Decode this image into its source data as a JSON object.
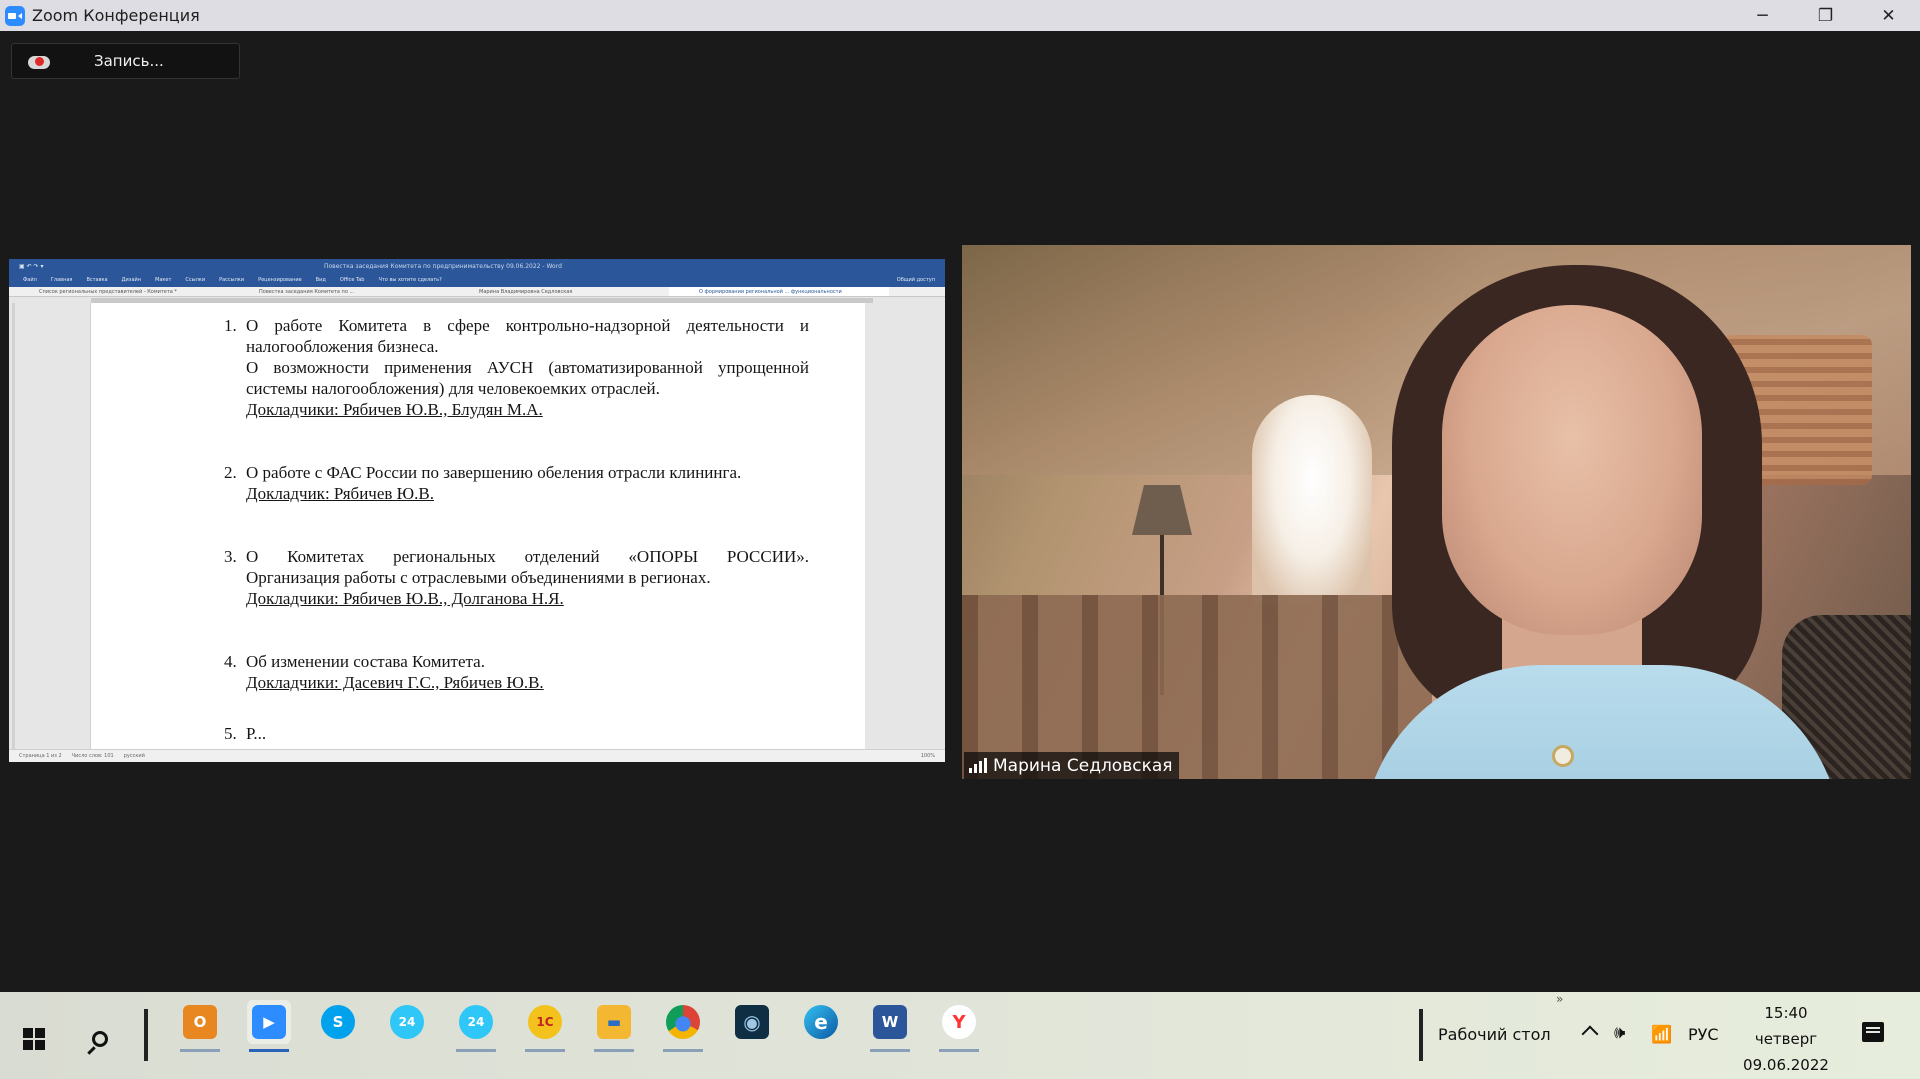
{
  "window": {
    "title": "Zoom Конференция",
    "minimize": "─",
    "restore": "❐",
    "close": "✕"
  },
  "recording": {
    "label": "Запись..."
  },
  "word": {
    "title_bar": "Повестка заседания Комитета по предпринимательству 09.06.2022 - Word",
    "ribbon_tabs": [
      "Файл",
      "Главная",
      "Вставка",
      "Дизайн",
      "Макет",
      "Ссылки",
      "Рассылки",
      "Рецензирование",
      "Вид",
      "Office Tab",
      "Что вы хотите сделать?"
    ],
    "share_label": "Общий доступ",
    "doc_tabs": [
      "Список региональных представителей - Комитета *",
      "Повестка заседания Комитета по ...",
      "Марина Владимировна Седловская",
      "О формировании региональной ... функциональности"
    ],
    "status_left": [
      "Страница 1 из 2",
      "Число слов: 101",
      "русский"
    ],
    "status_zoom": "100%",
    "items": [
      {
        "num": "1.",
        "line1": "О работе Комитета в сфере контрольно-надзорной деятельности и",
        "line2": "налогообложения бизнеса.",
        "line3": "О возможности применения АУСН (автоматизированной упрощенной",
        "line4": "системы налогообложения) для человекоемких отраслей.",
        "speakers": "Докладчики: Рябичев Ю.В., Блудян М.А."
      },
      {
        "num": "2.",
        "line1": "О работе с ФАС России по завершению обеления отрасли клининга.",
        "speakers": "Докладчик: Рябичев Ю.В."
      },
      {
        "num": "3.",
        "line1": "О Комитетах региональных отделений «ОПОРЫ РОССИИ».",
        "line2": "Организация работы с отраслевыми объединениями в регионах.",
        "speakers": "Докладчики: Рябичев Ю.В., Долганова Н.Я."
      },
      {
        "num": "4.",
        "line1": "Об изменении состава Комитета.",
        "speakers": "Докладчики: Дасевич Г.С., Рябичев Ю.В."
      },
      {
        "num": "5.",
        "line1": "Р..."
      }
    ]
  },
  "participant": {
    "name": "Марина Седловская"
  },
  "taskbar": {
    "apps": [
      {
        "name": "outlook",
        "label": "O",
        "color": "#e8861f"
      },
      {
        "name": "zoom",
        "label": "▶",
        "color": "#2d8cff"
      },
      {
        "name": "skype",
        "label": "S",
        "color": "#00a2ed"
      },
      {
        "name": "bitrix24-a",
        "label": "24",
        "color": "#2fc7f7"
      },
      {
        "name": "bitrix24-b",
        "label": "24",
        "color": "#2fc7f7"
      },
      {
        "name": "1c",
        "label": "1С",
        "color": "#f3c21c"
      },
      {
        "name": "file-explorer",
        "label": "▬",
        "color": "#f4b731"
      },
      {
        "name": "chrome",
        "label": "●",
        "color": "#db4437"
      },
      {
        "name": "camera-app",
        "label": "◉",
        "color": "#0f2e44"
      },
      {
        "name": "edge",
        "label": "e",
        "color": "#1b9de2"
      },
      {
        "name": "word",
        "label": "W",
        "color": "#2b579a"
      },
      {
        "name": "yandex",
        "label": "Y",
        "color": "#ffffff"
      }
    ],
    "desktop_label": "Рабочий стол",
    "language": "РУС",
    "time": "15:40",
    "weekday": "четверг",
    "date": "09.06.2022",
    "overflow": "»"
  }
}
